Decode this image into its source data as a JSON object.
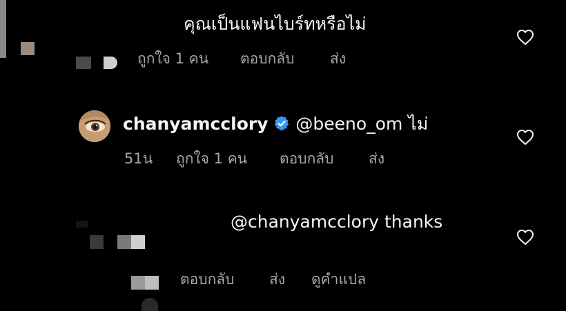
{
  "comment_1": {
    "text": "คุณเป็นแฟนไบร์ทหรือไม่",
    "likes": "ถูกใจ 1 คน",
    "reply": "ตอบกลับ",
    "send": "ส่ง"
  },
  "comment_2": {
    "username": "chanyamcclory",
    "mention": "@beeno_om",
    "text": "ไม่",
    "time": "51น",
    "likes": "ถูกใจ 1 คน",
    "reply": "ตอบกลับ",
    "send": "ส่ง"
  },
  "comment_3": {
    "text": "@chanyamcclory thanks",
    "reply": "ตอบกลับ",
    "send": "ส่ง",
    "translate": "ดูคำแปล"
  },
  "colors": {
    "background": "#000000",
    "text": "#f5f5f5",
    "meta": "#a8a8a8",
    "verified": "#3897f0"
  },
  "icons": [
    "heart-outline-icon",
    "verified-badge-icon"
  ]
}
